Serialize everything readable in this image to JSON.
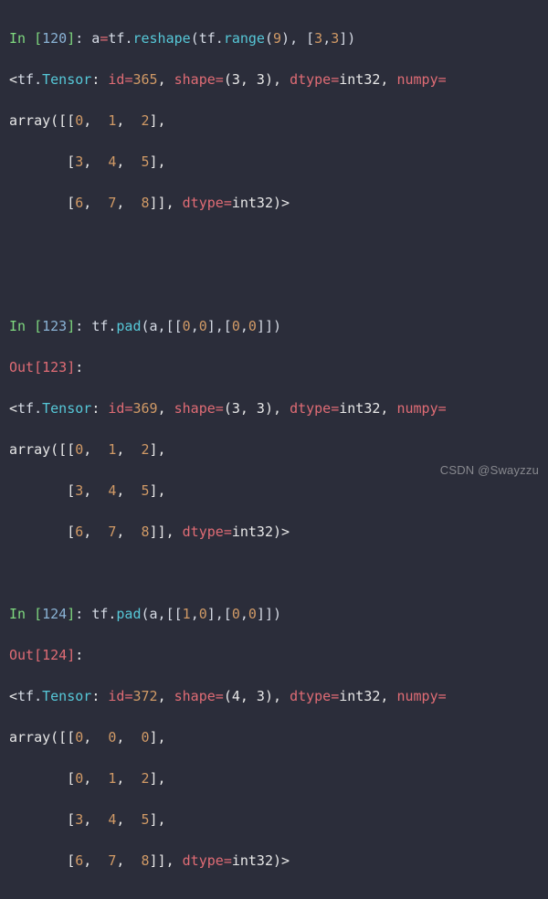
{
  "watermark": "CSDN @Swayzzu",
  "blocks": {
    "b1": {
      "in_num": "120",
      "code_prefix": ": a",
      "eq": "=",
      "tf1": "tf",
      "reshape": "reshape",
      "open1": "(",
      "tf2": "tf",
      "range": "range",
      "open2": "(",
      "nine": "9",
      "close2": ")",
      "comma1": ", [",
      "three_a": "3",
      "comma2": ",",
      "three_b": "3",
      "close_args": "])",
      "t_open": "<",
      "t_tf": "tf",
      "t_dot": ".",
      "t_tensor": "Tensor",
      "t_colon": ": ",
      "t_id_k": "id",
      "t_eq1": "=",
      "t_id_v": "365",
      "t_c1": ", ",
      "t_shape_k": "shape",
      "t_eq2": "=",
      "t_shape_v": "(3, 3)",
      "t_c2": ", ",
      "t_dtype_k": "dtype",
      "t_eq3": "=",
      "t_dtype_v": "int32",
      "t_c3": ", ",
      "t_numpy_k": "numpy",
      "t_eq4": "=",
      "arr_l1_pre": "array([[",
      "arr_l1_a": "0",
      "arr_l1_s1": ",  ",
      "arr_l1_b": "1",
      "arr_l1_s2": ",  ",
      "arr_l1_c": "2",
      "arr_l1_post": "],",
      "arr_l2_pre": "       [",
      "arr_l2_a": "3",
      "arr_l2_s1": ",  ",
      "arr_l2_b": "4",
      "arr_l2_s2": ",  ",
      "arr_l2_c": "5",
      "arr_l2_post": "],",
      "arr_l3_pre": "       [",
      "arr_l3_a": "6",
      "arr_l3_s1": ",  ",
      "arr_l3_b": "7",
      "arr_l3_s2": ",  ",
      "arr_l3_c": "8",
      "arr_l3_post": "]], ",
      "arr_dtype_k": "dtype",
      "arr_eq": "=",
      "arr_dtype_v": "int32",
      "arr_close": ")>"
    },
    "b2": {
      "in_num": "123",
      "out_num": "123",
      "code_prefix": ": ",
      "tf": "tf",
      "pad": "pad",
      "open": "(a,[[",
      "z1": "0",
      "c1": ",",
      "z2": "0",
      "mid": "],[",
      "z3": "0",
      "c2": ",",
      "z4": "0",
      "close": "]])",
      "out_colon": ":",
      "t_open": "<",
      "t_tf": "tf",
      "t_dot": ".",
      "t_tensor": "Tensor",
      "t_colon": ": ",
      "t_id_k": "id",
      "t_eq1": "=",
      "t_id_v": "369",
      "t_c1": ", ",
      "t_shape_k": "shape",
      "t_eq2": "=",
      "t_shape_v": "(3, 3)",
      "t_c2": ", ",
      "t_dtype_k": "dtype",
      "t_eq3": "=",
      "t_dtype_v": "int32",
      "t_c3": ", ",
      "t_numpy_k": "numpy",
      "t_eq4": "=",
      "arr_l1_pre": "array([[",
      "arr_l1_a": "0",
      "arr_l1_s1": ",  ",
      "arr_l1_b": "1",
      "arr_l1_s2": ",  ",
      "arr_l1_c": "2",
      "arr_l1_post": "],",
      "arr_l2_pre": "       [",
      "arr_l2_a": "3",
      "arr_l2_s1": ",  ",
      "arr_l2_b": "4",
      "arr_l2_s2": ",  ",
      "arr_l2_c": "5",
      "arr_l2_post": "],",
      "arr_l3_pre": "       [",
      "arr_l3_a": "6",
      "arr_l3_s1": ",  ",
      "arr_l3_b": "7",
      "arr_l3_s2": ",  ",
      "arr_l3_c": "8",
      "arr_l3_post": "]], ",
      "arr_dtype_k": "dtype",
      "arr_eq": "=",
      "arr_dtype_v": "int32",
      "arr_close": ")>"
    },
    "b3": {
      "in_num": "124",
      "out_num": "124",
      "code_prefix": ": ",
      "tf": "tf",
      "pad": "pad",
      "open": "(a,[[",
      "p1": "1",
      "c1": ",",
      "p2": "0",
      "mid": "],[",
      "p3": "0",
      "c2": ",",
      "p4": "0",
      "close": "]])",
      "out_colon": ":",
      "t_open": "<",
      "t_tf": "tf",
      "t_dot": ".",
      "t_tensor": "Tensor",
      "t_colon": ": ",
      "t_id_k": "id",
      "t_eq1": "=",
      "t_id_v": "372",
      "t_c1": ", ",
      "t_shape_k": "shape",
      "t_eq2": "=",
      "t_shape_v": "(4, 3)",
      "t_c2": ", ",
      "t_dtype_k": "dtype",
      "t_eq3": "=",
      "t_dtype_v": "int32",
      "t_c3": ", ",
      "t_numpy_k": "numpy",
      "t_eq4": "=",
      "arr_l1_pre": "array([[",
      "arr_l1_a": "0",
      "arr_l1_s1": ",  ",
      "arr_l1_b": "0",
      "arr_l1_s2": ",  ",
      "arr_l1_c": "0",
      "arr_l1_post": "],",
      "arr_l2_pre": "       [",
      "arr_l2_a": "0",
      "arr_l2_s1": ",  ",
      "arr_l2_b": "1",
      "arr_l2_s2": ",  ",
      "arr_l2_c": "2",
      "arr_l2_post": "],",
      "arr_l3_pre": "       [",
      "arr_l3_a": "3",
      "arr_l3_s1": ",  ",
      "arr_l3_b": "4",
      "arr_l3_s2": ",  ",
      "arr_l3_c": "5",
      "arr_l3_post": "],",
      "arr_l4_pre": "       [",
      "arr_l4_a": "6",
      "arr_l4_s1": ",  ",
      "arr_l4_b": "7",
      "arr_l4_s2": ",  ",
      "arr_l4_c": "8",
      "arr_l4_post": "]], ",
      "arr_dtype_k": "dtype",
      "arr_eq": "=",
      "arr_dtype_v": "int32",
      "arr_close": ")>"
    }
  },
  "labels": {
    "in": "In ",
    "out": "Out"
  }
}
